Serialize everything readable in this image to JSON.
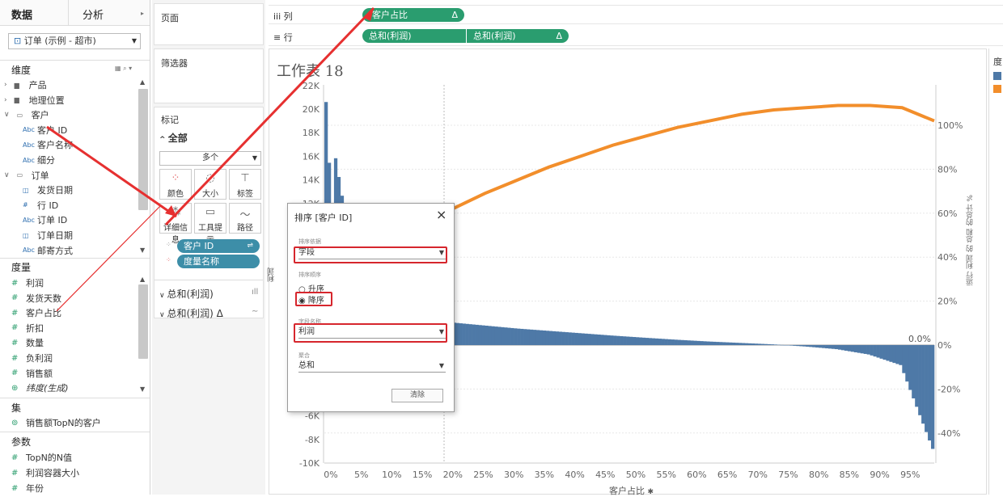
{
  "left_panel": {
    "tabs": [
      "数据",
      "分析"
    ],
    "datasource": "订单 (示例 - 超市)",
    "dimensions_header": "维度",
    "dimensions": [
      {
        "label": "产品",
        "type": "folder",
        "indent": 0
      },
      {
        "label": "地理位置",
        "type": "folder",
        "indent": 0
      },
      {
        "label": "客户",
        "type": "folder-open",
        "indent": 0
      },
      {
        "label": "客户 ID",
        "type": "abc",
        "indent": 1
      },
      {
        "label": "客户名称",
        "type": "abc",
        "indent": 1
      },
      {
        "label": "细分",
        "type": "abc",
        "indent": 1
      },
      {
        "label": "订单",
        "type": "folder-open",
        "indent": 0
      },
      {
        "label": "发货日期",
        "type": "date",
        "indent": 1
      },
      {
        "label": "行 ID",
        "type": "num",
        "indent": 1
      },
      {
        "label": "订单 ID",
        "type": "abc",
        "indent": 1
      },
      {
        "label": "订单日期",
        "type": "date",
        "indent": 1
      },
      {
        "label": "邮寄方式",
        "type": "abc",
        "indent": 1
      }
    ],
    "measures_header": "度量",
    "measures": [
      "利润",
      "发货天数",
      "客户占比",
      "折扣",
      "数量",
      "负利润",
      "销售额",
      "纬度(生成)"
    ],
    "sets_header": "集",
    "sets": [
      "销售额TopN的客户"
    ],
    "params_header": "参数",
    "params": [
      "TopN的N值",
      "利润容器大小",
      "年份"
    ]
  },
  "mid_panel": {
    "pages_label": "页面",
    "filters_label": "筛选器",
    "marks_label": "标记",
    "all_label": "全部",
    "mark_type": "多个",
    "mark_buttons": [
      "颜色",
      "大小",
      "标签",
      "详细信息",
      "工具提示",
      "路径"
    ],
    "mark_pills": [
      "客户 ID",
      "度量名称"
    ],
    "sections": [
      "总和(利润)",
      "总和(利润) Δ"
    ]
  },
  "shelves": {
    "columns_label": "iii 列",
    "rows_label": "≡ 行",
    "column_pill": "客户占比",
    "row_pills": [
      "总和(利润)",
      "总和(利润)"
    ]
  },
  "sheet": {
    "title": "工作表 18",
    "legend_title": "度",
    "x_axis_label": "客户占比",
    "left_ticks": [
      "22K",
      "20K",
      "18K",
      "16K",
      "14K",
      "12K",
      "-6K",
      "-8K",
      "-10K"
    ],
    "right_ticks": [
      "100%",
      "80%",
      "60%",
      "40%",
      "20%",
      "0%",
      "-20%",
      "-40%"
    ],
    "right_axis_label": "运行 利润 的 总和 的总计 %",
    "x_ticks": [
      "0%",
      "5%",
      "10%",
      "15%",
      "20%",
      "25%",
      "30%",
      "35%",
      "40%",
      "45%",
      "50%",
      "55%",
      "60%",
      "65%",
      "70%",
      "75%",
      "80%",
      "85%",
      "90%",
      "95%"
    ],
    "zero_label": "0.0%",
    "colors": {
      "bar": "#4e79a7",
      "line": "#f28e2b",
      "accent": "#2a9d6f"
    }
  },
  "chart_data": {
    "type": "bar",
    "title": "工作表 18",
    "xlabel": "客户占比",
    "ylabel": "利润",
    "y2label": "运行 利润 的 总和 的总计 %",
    "x": [
      0,
      5,
      10,
      15,
      20,
      25,
      30,
      35,
      40,
      45,
      50,
      55,
      60,
      65,
      70,
      75,
      80,
      85,
      90,
      95
    ],
    "series": [
      {
        "values": [
          20600,
          4800,
          2900,
          2300,
          1900,
          1650,
          1400,
          1200,
          1000,
          800,
          620,
          450,
          300,
          180,
          60,
          -120,
          -350,
          -800,
          -1700,
          -8800
        ]
      },
      {
        "values": [
          5,
          30,
          45,
          55,
          62,
          69,
          75,
          81,
          86,
          91,
          95,
          99,
          102,
          105,
          107,
          108,
          109,
          109,
          108,
          102
        ]
      }
    ]
  },
  "dialog": {
    "title": "排序 [客户 ID]",
    "sort_by_label": "排序依据",
    "sort_by_value": "字段",
    "order_label": "排序顺序",
    "asc_label": "升序",
    "desc_label": "降序",
    "field_label": "字段名称",
    "field_value": "利润",
    "agg_label": "聚合",
    "agg_value": "总和",
    "clear_label": "清除",
    "close_icon": "×"
  }
}
